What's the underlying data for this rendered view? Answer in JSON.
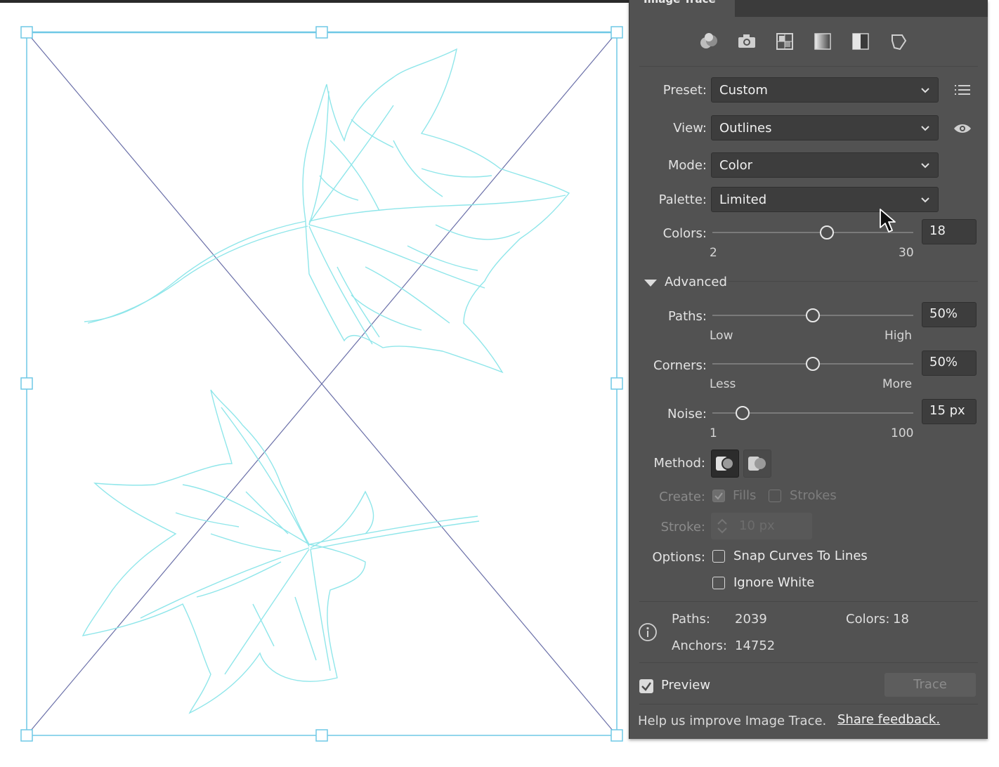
{
  "panel": {
    "title": "Image Trace",
    "toolbar_icons": [
      "auto-color-icon",
      "high-color-photo-icon",
      "low-color-icon",
      "grayscale-icon",
      "black-white-icon",
      "outline-icon"
    ],
    "preset": {
      "label": "Preset:",
      "value": "Custom"
    },
    "view": {
      "label": "View:",
      "value": "Outlines"
    },
    "mode": {
      "label": "Mode:",
      "value": "Color"
    },
    "palette": {
      "label": "Palette:",
      "value": "Limited"
    },
    "colors": {
      "label": "Colors:",
      "value": "18",
      "min": "2",
      "max": "30",
      "level": 0.57
    },
    "advanced": {
      "label": "Advanced"
    },
    "paths": {
      "label": "Paths:",
      "value": "50%",
      "min_label": "Low",
      "max_label": "High",
      "level": 0.5
    },
    "corners": {
      "label": "Corners:",
      "value": "50%",
      "min_label": "Less",
      "max_label": "More",
      "level": 0.5
    },
    "noise": {
      "label": "Noise:",
      "value": "15 px",
      "min": "1",
      "max": "100",
      "level": 0.15
    },
    "method": {
      "label": "Method:"
    },
    "create": {
      "label": "Create:",
      "fills": "Fills",
      "strokes": "Strokes",
      "fills_checked": true,
      "strokes_checked": false
    },
    "stroke": {
      "label": "Stroke:",
      "value": "10 px"
    },
    "options": {
      "label": "Options:",
      "snap": "Snap Curves To Lines",
      "ignore_white": "Ignore White"
    },
    "info": {
      "paths_label": "Paths:",
      "paths_value": "2039",
      "colors_label": "Colors:",
      "colors_value": "18",
      "anchors_label": "Anchors:",
      "anchors_value": "14752"
    },
    "preview": {
      "label": "Preview",
      "checked": true
    },
    "trace_button": "Trace",
    "help_text": "Help us improve Image Trace.",
    "feedback_link": "Share feedback."
  },
  "colors": {
    "panel_bg": "#525252",
    "trace_cyan": "#8fe6ea",
    "selection_blue": "#6fc8e6",
    "diagonal": "#6a6fa8"
  }
}
